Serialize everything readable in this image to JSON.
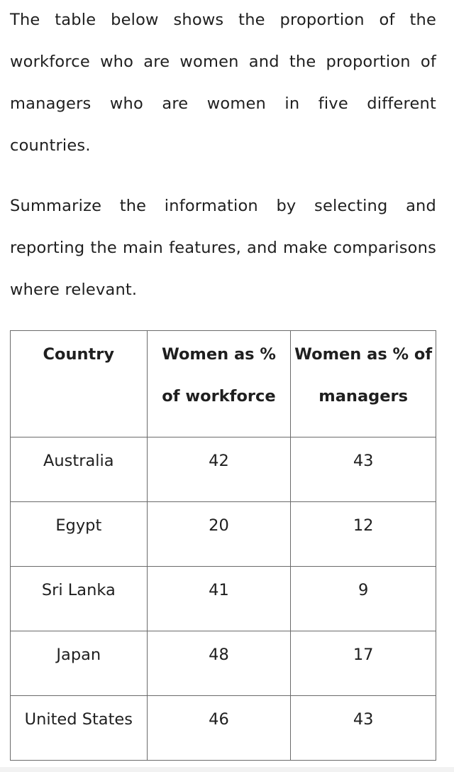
{
  "prompt": {
    "paragraph1": "The table below shows the proportion of the workforce who are women and the proportion of managers who are women in five different countries.",
    "paragraph2": "Summarize the information by selecting and reporting the main features, and make comparisons where relevant."
  },
  "table": {
    "headers": [
      "Country",
      "Women as % of workforce",
      "Women as % of managers"
    ],
    "rows": [
      [
        "Australia",
        "42",
        "43"
      ],
      [
        "Egypt",
        "20",
        "12"
      ],
      [
        "Sri Lanka",
        "41",
        "9"
      ],
      [
        "Japan",
        "48",
        "17"
      ],
      [
        "United States",
        "46",
        "43"
      ]
    ]
  }
}
